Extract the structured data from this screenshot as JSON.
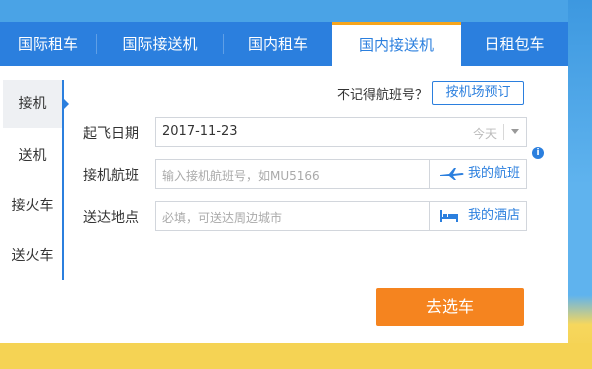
{
  "tabs": [
    {
      "label": "国际租车"
    },
    {
      "label": "国际接送机"
    },
    {
      "label": "国内租车"
    },
    {
      "label": "国内接送机"
    },
    {
      "label": "日租包车"
    }
  ],
  "sidebar": {
    "items": [
      {
        "label": "接机"
      },
      {
        "label": "送机"
      },
      {
        "label": "接火车"
      },
      {
        "label": "送火车"
      }
    ]
  },
  "form": {
    "hint": "不记得航班号？",
    "reserve_button": "按机场预订",
    "date_label": "起飞日期",
    "date_value": "2017-11-23",
    "today_label": "今天",
    "flight_label": "接机航班",
    "flight_placeholder": "输入接机航班号，如MU5166",
    "my_flight": "我的航班",
    "dest_label": "送达地点",
    "dest_placeholder": "必填，可送达周边城市",
    "my_hotel": "我的酒店",
    "submit": "去选车"
  },
  "colors": {
    "primary": "#2b7fde",
    "accent": "#f5841f",
    "tab_indicator": "#f7a51c"
  }
}
